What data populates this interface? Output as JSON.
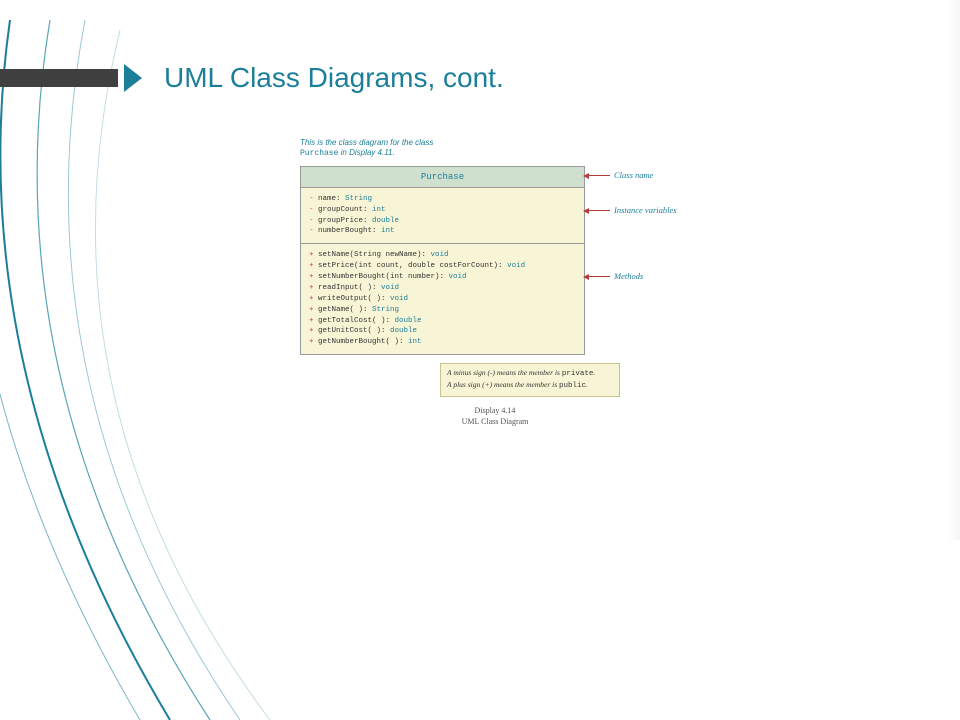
{
  "title": "UML Class Diagrams, cont.",
  "intro_line1": "This is the class diagram for the class",
  "intro_class": "Purchase",
  "intro_line2": " in Display 4.11.",
  "uml": {
    "class_name": "Purchase",
    "attributes": [
      {
        "vis": "-",
        "name": "name",
        "type": "String"
      },
      {
        "vis": "-",
        "name": "groupCount",
        "type": "int"
      },
      {
        "vis": "-",
        "name": "groupPrice",
        "type": "double"
      },
      {
        "vis": "-",
        "name": "numberBought",
        "type": "int"
      }
    ],
    "methods": [
      {
        "vis": "+",
        "sig": "setName(String newName)",
        "ret": "void"
      },
      {
        "vis": "+",
        "sig": "setPrice(int count, double costForCount)",
        "ret": "void"
      },
      {
        "vis": "+",
        "sig": "setNumberBought(int number)",
        "ret": "void"
      },
      {
        "vis": "+",
        "sig": "readInput( )",
        "ret": "void"
      },
      {
        "vis": "+",
        "sig": "writeOutput( )",
        "ret": "void"
      },
      {
        "vis": "+",
        "sig": "getName( )",
        "ret": "String"
      },
      {
        "vis": "+",
        "sig": "getTotalCost( )",
        "ret": "double"
      },
      {
        "vis": "+",
        "sig": "getUnitCost( )",
        "ret": "double"
      },
      {
        "vis": "+",
        "sig": "getNumberBought( )",
        "ret": "int"
      }
    ]
  },
  "annotations": {
    "class_name": "Class name",
    "instance_vars": "Instance variables",
    "methods": "Methods"
  },
  "note": {
    "line1_a": "A minus sign (-) means the member is ",
    "line1_b": "private",
    "line1_c": ".",
    "line2_a": "A plus sign (+) means the member is ",
    "line2_b": "public",
    "line2_c": "."
  },
  "caption": {
    "num": "Display 4.14",
    "text": "UML Class Diagram"
  }
}
